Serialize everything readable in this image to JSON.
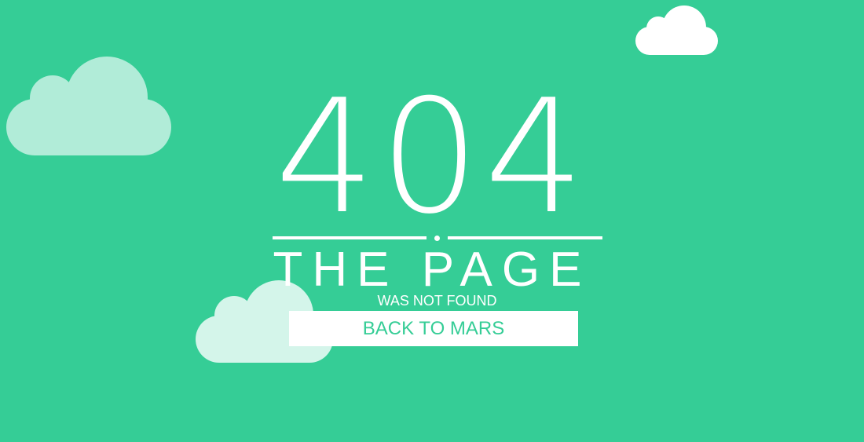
{
  "colors": {
    "background": "#35cd96",
    "text": "#ffffff",
    "button_background": "#ffffff",
    "button_text": "#35cd96",
    "cloud_left": "#b1ecd8",
    "cloud_top_right": "#ffffff",
    "cloud_bottom": "#d4f5ea"
  },
  "error": {
    "code": "404",
    "headline": "THE PAGE",
    "subline": "WAS NOT FOUND",
    "button_label": "BACK TO MARS"
  },
  "decorations": {
    "clouds": [
      {
        "name": "cloud-left-icon"
      },
      {
        "name": "cloud-top-right-icon"
      },
      {
        "name": "cloud-bottom-icon"
      }
    ]
  }
}
